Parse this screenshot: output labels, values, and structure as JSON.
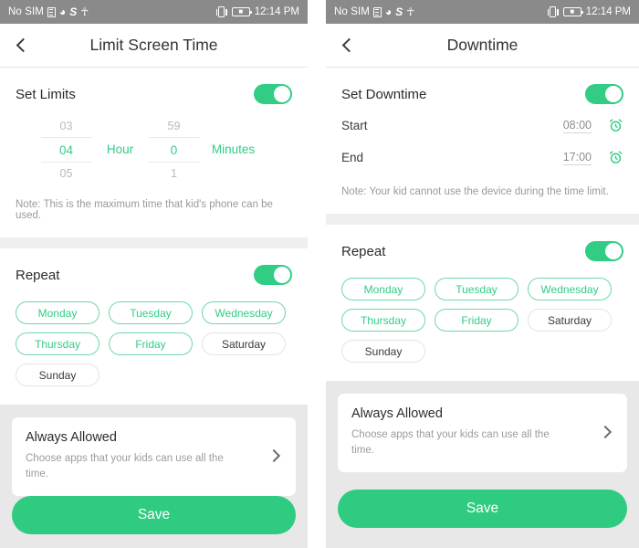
{
  "theme": {
    "accent": "#31cd84",
    "accent_button": "#2ecb80",
    "chip_border_on": "#6fd8a7",
    "status_bar_bg": "#8a8a8a",
    "page_bg": "#e8e8e8"
  },
  "status_bar": {
    "carrier": "No SIM",
    "icons": [
      "sim-card-icon",
      "wifi-icon",
      "s-glyph-icon",
      "usb-icon",
      "vibrate-icon",
      "battery-charging-icon"
    ],
    "time": "12:14 PM"
  },
  "left_screen": {
    "title": "Limit Screen Time",
    "back_icon": "chevron-left-icon",
    "set_limits": {
      "label": "Set Limits",
      "toggle_on": true,
      "picker": {
        "hour": {
          "prev": "03",
          "selected": "04",
          "next": "05",
          "unit": "Hour"
        },
        "minute": {
          "prev": "59",
          "selected": "0",
          "next": "1",
          "unit": "Minutes"
        }
      },
      "note": "Note: This is the maximum time that kid's phone can be used."
    },
    "repeat": {
      "label": "Repeat",
      "toggle_on": true,
      "days": [
        {
          "label": "Monday",
          "selected": true
        },
        {
          "label": "Tuesday",
          "selected": true
        },
        {
          "label": "Wednesday",
          "selected": true
        },
        {
          "label": "Thursday",
          "selected": true
        },
        {
          "label": "Friday",
          "selected": true
        },
        {
          "label": "Saturday",
          "selected": false
        },
        {
          "label": "Sunday",
          "selected": false
        }
      ]
    },
    "always_allowed": {
      "title": "Always Allowed",
      "subtitle": "Choose apps that your kids can use all the time.",
      "chevron_icon": "chevron-right-icon"
    },
    "save_label": "Save"
  },
  "right_screen": {
    "title": "Downtime",
    "back_icon": "chevron-left-icon",
    "set_downtime": {
      "label": "Set Downtime",
      "toggle_on": true,
      "start": {
        "label": "Start",
        "value": "08:00",
        "icon": "alarm-clock-icon"
      },
      "end": {
        "label": "End",
        "value": "17:00",
        "icon": "alarm-clock-icon"
      },
      "note": "Note: Your kid cannot use the device during the time limit."
    },
    "repeat": {
      "label": "Repeat",
      "toggle_on": true,
      "days": [
        {
          "label": "Monday",
          "selected": true
        },
        {
          "label": "Tuesday",
          "selected": true
        },
        {
          "label": "Wednesday",
          "selected": true
        },
        {
          "label": "Thursday",
          "selected": true
        },
        {
          "label": "Friday",
          "selected": true
        },
        {
          "label": "Saturday",
          "selected": false
        },
        {
          "label": "Sunday",
          "selected": false
        }
      ]
    },
    "always_allowed": {
      "title": "Always Allowed",
      "subtitle": "Choose apps that your kids can use all the time.",
      "chevron_icon": "chevron-right-icon"
    },
    "save_label": "Save"
  }
}
